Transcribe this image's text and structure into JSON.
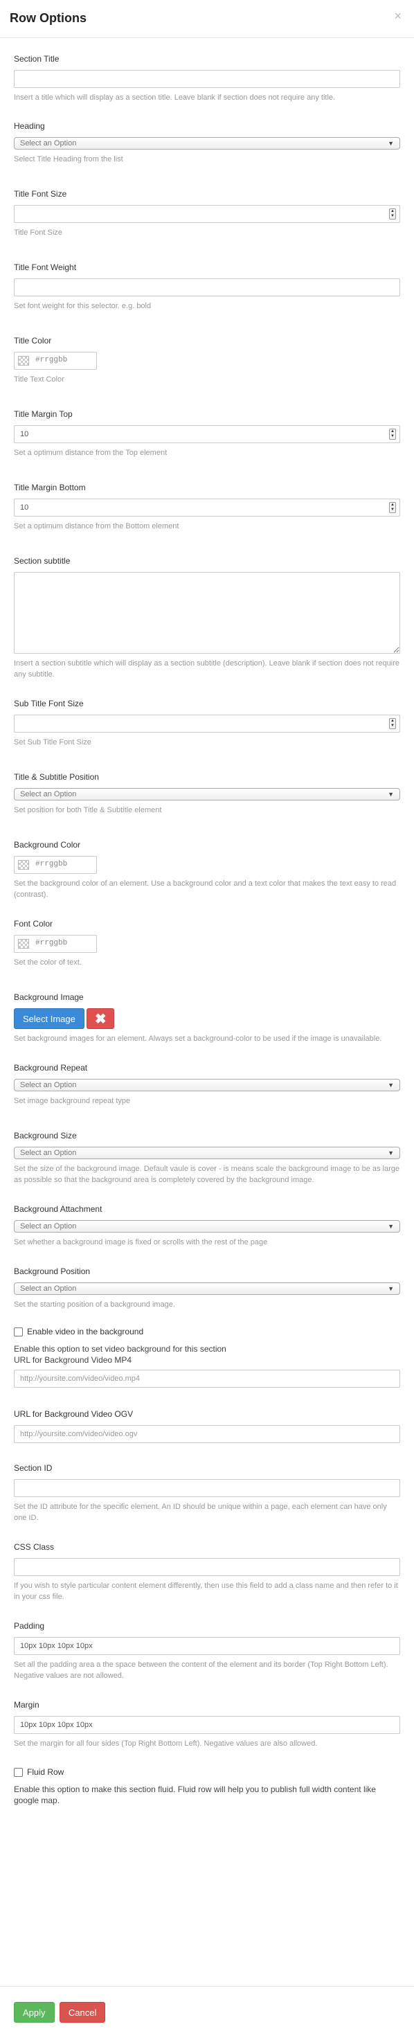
{
  "modal": {
    "title": "Row Options",
    "close": "×"
  },
  "section_title": {
    "label": "Section Title",
    "value": "",
    "help": "Insert a title which will display as a section title. Leave blank if section does not require any title."
  },
  "heading": {
    "label": "Heading",
    "selected": "Select an Option",
    "help": "Select Title Heading from the list"
  },
  "title_font_size": {
    "label": "Title Font Size",
    "value": "",
    "help": "Title Font Size"
  },
  "title_font_weight": {
    "label": "Title Font Weight",
    "value": "",
    "help": "Set font weight for this selector. e.g. bold"
  },
  "title_color": {
    "label": "Title Color",
    "value": "#rrggbb",
    "help": "Title Text Color"
  },
  "title_margin_top": {
    "label": "Title Margin Top",
    "value": "10",
    "help": "Set a optimum distance from the Top element"
  },
  "title_margin_bottom": {
    "label": "Title Margin Bottom",
    "value": "10",
    "help": "Set a optimum distance from the Bottom element"
  },
  "section_subtitle": {
    "label": "Section subtitle",
    "value": "",
    "help": "Insert a section subtitle which will display as a section subtitle (description). Leave blank if section does not require any subtitle."
  },
  "sub_title_font_size": {
    "label": "Sub Title Font Size",
    "value": "",
    "help": "Set Sub Title Font Size"
  },
  "title_subtitle_position": {
    "label": "Title & Subtitle Position",
    "selected": "Select an Option",
    "help": "Set position for both Title & Subtitle element"
  },
  "background_color": {
    "label": "Background Color",
    "value": "#rrggbb",
    "help": "Set the background color of an element. Use a background color and a text color that makes the text easy to read (contrast)."
  },
  "font_color": {
    "label": "Font Color",
    "value": "#rrggbb",
    "help": "Set the color of text."
  },
  "background_image": {
    "label": "Background Image",
    "select_button": "Select Image",
    "remove_button": "✖",
    "help": "Set background images for an element. Always set a background-color to be used if the image is unavailable."
  },
  "background_repeat": {
    "label": "Background Repeat",
    "selected": "Select an Option",
    "help": "Set image background repeat type"
  },
  "background_size": {
    "label": "Background Size",
    "selected": "Select an Option",
    "help": "Set the size of the background image. Default vaule is cover - is means scale the background image to be as large as possible so that the background area is completely covered by the background image."
  },
  "background_attachment": {
    "label": "Background Attachment",
    "selected": "Select an Option",
    "help": "Set whether a background image is fixed or scrolls with the rest of the page"
  },
  "background_position": {
    "label": "Background Position",
    "selected": "Select an Option",
    "help": "Set the starting position of a background image."
  },
  "video": {
    "checkbox_label": "Enable video in the background",
    "description": "Enable this option to set video background for this section",
    "mp4_label": "URL for Background Video MP4",
    "mp4_placeholder": "http://yoursite.com/video/video.mp4",
    "ogv_label": "URL for Background Video OGV",
    "ogv_placeholder": "http://yoursite.com/video/video.ogv"
  },
  "section_id": {
    "label": "Section ID",
    "value": "",
    "help": "Set the ID attribute for the specific element. An ID should be unique within a page, each element can have only one ID."
  },
  "css_class": {
    "label": "CSS Class",
    "value": "",
    "help": "If you wish to style particular content element differently, then use this field to add a class name and then refer to it in your css file."
  },
  "padding": {
    "label": "Padding",
    "value": "10px 10px 10px 10px",
    "help": "Set all the padding area a the space between the content of the element and its border (Top Right Bottom Left). Negative values are not allowed."
  },
  "margin": {
    "label": "Margin",
    "value": "10px 10px 10px 10px",
    "help": "Set the margin for all four sides (Top Right Bottom Left). Negative values are also allowed."
  },
  "fluid_row": {
    "checkbox_label": "Fluid Row",
    "help": "Enable this option to make this section fluid. Fluid row will help you to publish full width content like google map."
  },
  "footer": {
    "apply": "Apply",
    "cancel": "Cancel"
  },
  "icons": {
    "close": "close-icon",
    "chevron": "chevron-down-icon",
    "spinner": "spinner-arrows-icon",
    "remove": "remove-icon"
  },
  "colors": {
    "primary_blue": "#3a8ad8",
    "remove_red": "#e05050",
    "apply_green": "#5cb85c",
    "cancel_red": "#d9534f"
  }
}
